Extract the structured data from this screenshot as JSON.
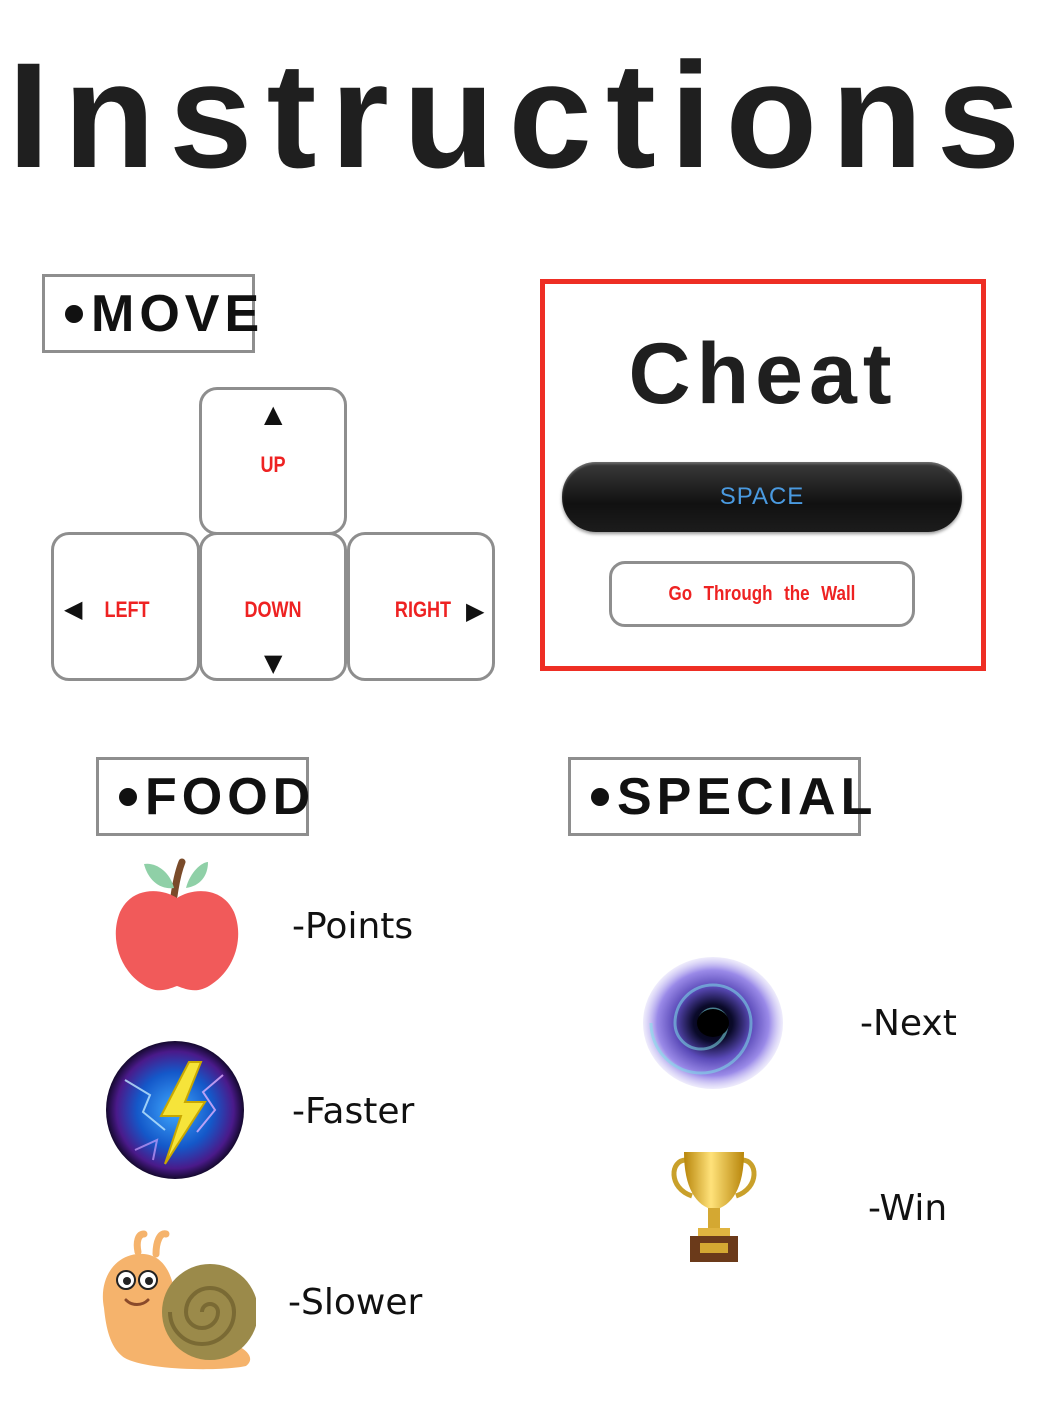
{
  "title": "Instructions",
  "move": {
    "label": "MOVE",
    "keys": {
      "up": "UP",
      "left": "LEFT",
      "down": "DOWN",
      "right": "RIGHT"
    }
  },
  "cheat": {
    "title": "Cheat",
    "key": "SPACE",
    "description": "Go Through the Wall"
  },
  "food": {
    "label": "FOOD",
    "items": [
      {
        "icon": "apple-icon",
        "label": "-Points"
      },
      {
        "icon": "lightning-orb-icon",
        "label": "-Faster"
      },
      {
        "icon": "snail-icon",
        "label": "-Slower"
      }
    ]
  },
  "special": {
    "label": "SPECIAL",
    "items": [
      {
        "icon": "black-hole-icon",
        "label": "-Next"
      },
      {
        "icon": "trophy-icon",
        "label": "-Win"
      }
    ]
  },
  "colors": {
    "accent_red": "#ee2e24",
    "key_text": "#ee2222",
    "space_text": "#4a9ae0"
  }
}
